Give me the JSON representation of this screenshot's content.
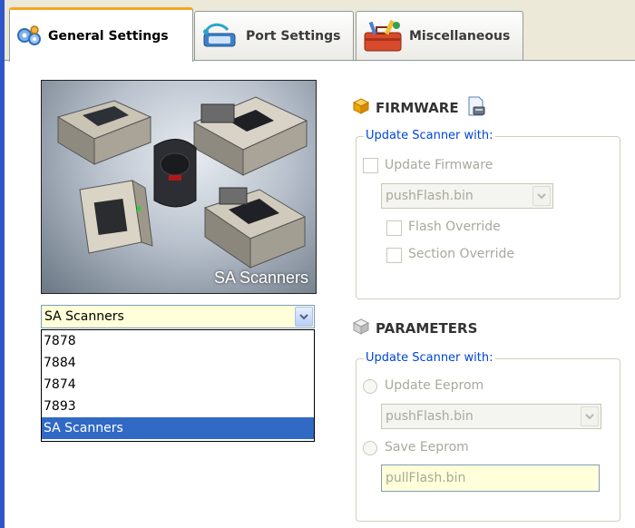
{
  "tabs": [
    {
      "label": "General Settings",
      "icon": "gears-icon",
      "active": true
    },
    {
      "label": "Port Settings",
      "icon": "port-icon",
      "active": false
    },
    {
      "label": "Miscellaneous",
      "icon": "toolbox-icon",
      "active": false
    }
  ],
  "scanner_image": {
    "caption": "SA Scanners"
  },
  "scanner_select": {
    "value": "SA Scanners",
    "options": [
      "7878",
      "7884",
      "7874",
      "7893",
      "SA Scanners"
    ],
    "selected_index": 4
  },
  "firmware": {
    "title": "FIRMWARE",
    "group_legend": "Update Scanner with:",
    "update_firmware_label": "Update Firmware",
    "file_value": "pushFlash.bin",
    "flash_override_label": "Flash Override",
    "section_override_label": "Section Override"
  },
  "parameters": {
    "title": "PARAMETERS",
    "group_legend": "Update Scanner with:",
    "update_eeprom_label": "Update Eeprom",
    "update_file_value": "pushFlash.bin",
    "save_eeprom_label": "Save Eeprom",
    "save_file_value": "pullFlash.bin"
  },
  "colors": {
    "active_tab_accent": "#f5a623",
    "selection": "#316ac5",
    "legend_text": "#0046d5",
    "window_border": "#2f56c9"
  }
}
